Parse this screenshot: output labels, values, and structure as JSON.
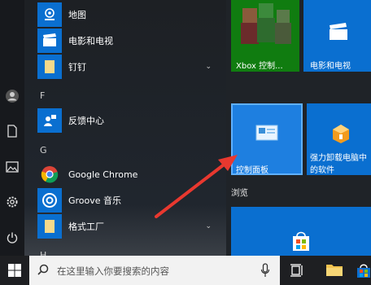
{
  "apps": {
    "items": [
      {
        "label": "地图"
      },
      {
        "label": "电影和电视"
      },
      {
        "label": "钉钉"
      },
      {
        "label": "反馈中心"
      },
      {
        "label": "Google Chrome"
      },
      {
        "label": "Groove 音乐"
      },
      {
        "label": "格式工厂"
      }
    ],
    "letters": [
      "F",
      "G",
      "H"
    ]
  },
  "tiles": {
    "xbox": "Xbox 控制...",
    "movies": "电影和电视",
    "control": "控制面板",
    "uninstall_line1": "强力卸载电脑中",
    "uninstall_line2": "的软件",
    "browse_group": "浏览"
  },
  "taskbar": {
    "search_placeholder": "在这里输入你要搜索的内容"
  },
  "colors": {
    "accent": "#0078d7",
    "xbox": "#107c10",
    "selected_tile": "#1e7fe0",
    "arrow": "#e8382f"
  },
  "icons": [
    "user-icon",
    "document-icon",
    "pictures-icon",
    "settings-icon",
    "power-icon",
    "windows-start-icon",
    "search-icon",
    "microphone-icon",
    "task-view-icon",
    "file-explorer-icon",
    "store-icon",
    "chevron-down-icon"
  ]
}
